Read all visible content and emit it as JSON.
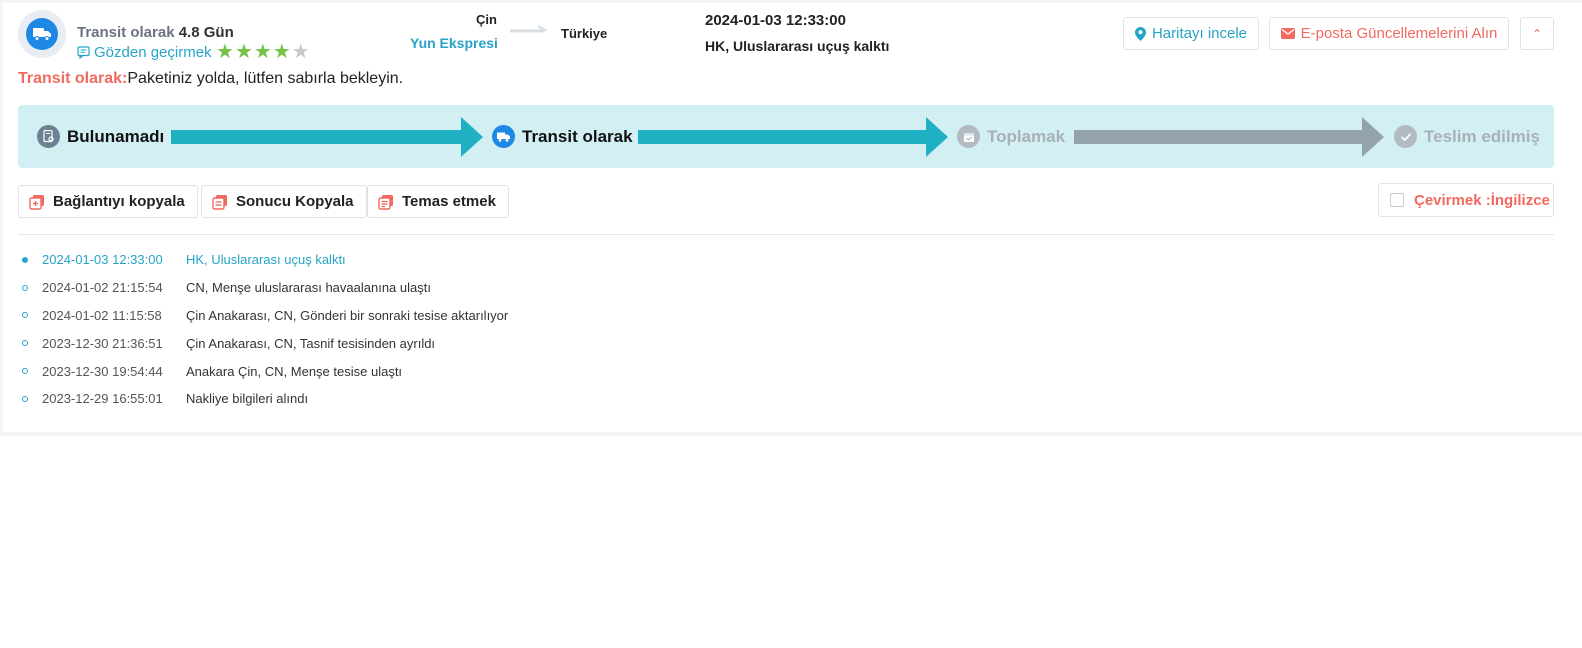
{
  "header": {
    "status_label": "Transit olarak",
    "days": "4.8 Gün",
    "review_link": "Gözden geçirmek",
    "rating": 4,
    "rating_max": 5,
    "origin": "Çin",
    "carrier": "Yun Ekspresi",
    "destination": "Türkiye",
    "latest_time": "2024-01-03 12:33:00",
    "latest_desc": "HK, Uluslararası uçuş kalktı",
    "map_button": "Haritayı incele",
    "email_button": "E-posta Güncellemelerini Alın",
    "collapse_glyph": "⌃"
  },
  "summary": {
    "label": "Transit olarak:",
    "text": "Paketiniz yolda, lütfen sabırla bekleyin."
  },
  "progress": {
    "steps": [
      {
        "label": "Bulunamadı",
        "state": "done",
        "icon": "document-search-icon"
      },
      {
        "label": "Transit olarak",
        "state": "done",
        "icon": "truck-icon"
      },
      {
        "label": "Toplamak",
        "state": "pending",
        "icon": "calendar-icon"
      },
      {
        "label": "Teslim edilmiş",
        "state": "pending",
        "icon": "check-icon"
      }
    ],
    "colors": {
      "done": "#1fb0c4",
      "pending": "#93a3a9"
    }
  },
  "actions": {
    "copy_link": "Bağlantıyı kopyala",
    "copy_result": "Sonucu Kopyala",
    "contact": "Temas etmek",
    "translate": "Çevirmek :İngilizce"
  },
  "events": [
    {
      "time": "2024-01-03 12:33:00",
      "desc": "HK, Uluslararası uçuş kalktı"
    },
    {
      "time": "2024-01-02 21:15:54",
      "desc": "CN, Menşe uluslararası havaalanına ulaştı"
    },
    {
      "time": "2024-01-02 11:15:58",
      "desc": "Çin Anakarası, CN, Gönderi bir sonraki tesise aktarılıyor"
    },
    {
      "time": "2023-12-30 21:36:51",
      "desc": "Çin Anakarası, CN, Tasnif tesisinden ayrıldı"
    },
    {
      "time": "2023-12-30 19:54:44",
      "desc": "Anakara Çin, CN, Menşe tesise ulaştı"
    },
    {
      "time": "2023-12-29 16:55:01",
      "desc": "Nakliye bilgileri alındı"
    }
  ],
  "colors": {
    "accent": "#26a4c8",
    "alert": "#f06a5f",
    "star_on": "#76c34a",
    "star_off": "#c9c9c9"
  }
}
